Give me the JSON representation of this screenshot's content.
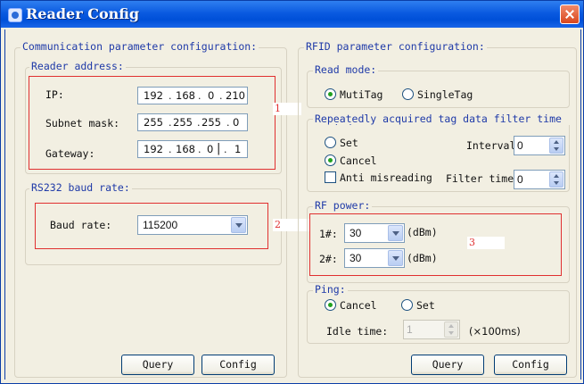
{
  "window": {
    "title": "Reader Config"
  },
  "comm": {
    "legend": "Communication parameter configuration:",
    "reader_address": {
      "legend": "Reader address:",
      "ip_label": "IP:",
      "ip": [
        "192",
        "168",
        "0",
        "210"
      ],
      "subnet_label": "Subnet mask:",
      "subnet": [
        "255",
        "255",
        "255",
        "0"
      ],
      "gateway_label": "Gateway:",
      "gateway": [
        "192",
        "168",
        "0",
        "1"
      ]
    },
    "baud": {
      "legend": "RS232 baud rate:",
      "label": "Baud rate:",
      "value": "115200"
    },
    "query_button": "Query",
    "config_button": "Config"
  },
  "rfid": {
    "legend": "RFID parameter configuration:",
    "read_mode": {
      "legend": "Read mode:",
      "options": [
        "MutiTag",
        "SingleTag"
      ],
      "selected": "MutiTag"
    },
    "filter": {
      "legend": "Repeatedly acquired tag data filter time period",
      "set_label": "Set",
      "cancel_label": "Cancel",
      "selected": "Cancel",
      "interval_label": "Interval",
      "interval_value": "0",
      "anti_label": "Anti misreading",
      "anti_checked": false,
      "filter_time_label": "Filter time",
      "filter_time_value": "0"
    },
    "rf_power": {
      "legend": "RF power:",
      "ant1_label": "1#:",
      "ant1_value": "30",
      "ant2_label": "2#:",
      "ant2_value": "30",
      "unit": "(dBm)"
    },
    "ping": {
      "legend": "Ping:",
      "cancel_label": "Cancel",
      "set_label": "Set",
      "selected": "Cancel",
      "idle_label": "Idle time:",
      "idle_value": "1",
      "idle_unit": "(×100ms)"
    },
    "query_button": "Query",
    "config_button": "Config"
  },
  "annotations": {
    "box1": "1",
    "box2": "2",
    "box3": "3"
  },
  "colors": {
    "title_bar": "#0a5ae0",
    "legend_text": "#1f3aa8",
    "annotation_red": "#e03030",
    "radio_dot": "#21a121"
  }
}
